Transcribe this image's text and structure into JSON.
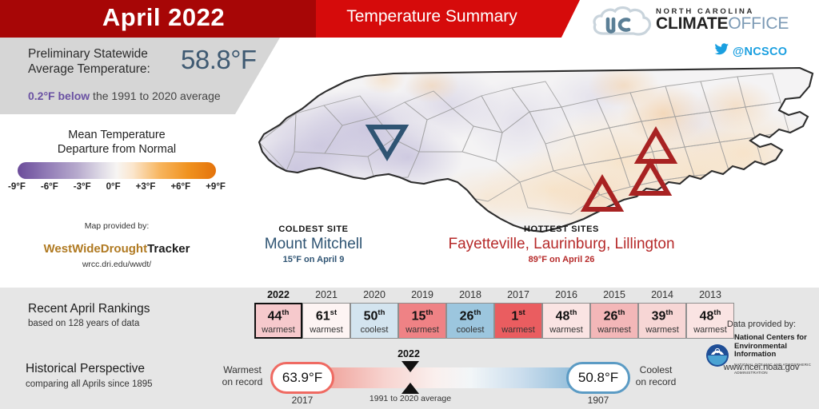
{
  "header": {
    "month_title": "April 2022",
    "summary_title": "Temperature Summary",
    "logo": {
      "line1": "NORTH CAROLINA",
      "climate": "CLIMATE",
      "office": "OFFICE"
    },
    "twitter_handle": "@NCSCO",
    "colors": {
      "banner_dark_red": "#A70606",
      "banner_bright_red": "#D60B0B"
    }
  },
  "stat_panel": {
    "label": "Preliminary Statewide Average Temperature:",
    "label_line1": "Preliminary Statewide",
    "label_line2": "Average Temperature:",
    "value": "58.8°F",
    "departure_value": "0.2°F below",
    "departure_rest": " the 1991 to 2020 average",
    "value_color": "#3f5a72",
    "departure_color": "#6a51a3"
  },
  "legend": {
    "title_line1": "Mean Temperature",
    "title_line2": "Departure from Normal",
    "ticks": [
      "-9°F",
      "-6°F",
      "-3°F",
      "0°F",
      "+3°F",
      "+6°F",
      "+9°F"
    ],
    "gradient_start": "#6b4c9a",
    "gradient_mid": "#f7f5f3",
    "gradient_end": "#e4730b"
  },
  "map_credit": {
    "label": "Map provided by:",
    "brand_part1": "WestWideDrought",
    "brand_part2": "Tracker",
    "url": "wrcc.dri.edu/wwdt/",
    "brand_color": "#b07a22"
  },
  "callouts": {
    "coldest": {
      "kicker": "COLDEST SITE",
      "name": "Mount Mitchell",
      "detail": "15°F on April 9",
      "color": "#2f5473"
    },
    "hottest": {
      "kicker": "HOTTEST SITES",
      "name": "Fayetteville, Laurinburg, Lillington",
      "detail": "89°F on April 26",
      "color": "#b62a2a"
    }
  },
  "rankings": {
    "title": "Recent April Rankings",
    "subtitle": "based on 128 years of data",
    "years": [
      "2022",
      "2021",
      "2020",
      "2019",
      "2018",
      "2017",
      "2016",
      "2015",
      "2014",
      "2013"
    ],
    "cells": [
      {
        "rank": "44",
        "suffix": "th",
        "word": "warmest",
        "bg": "#f6c9cc",
        "current": true
      },
      {
        "rank": "61",
        "suffix": "st",
        "word": "warmest",
        "bg": "#fdf4f3",
        "current": false
      },
      {
        "rank": "50",
        "suffix": "th",
        "word": "coolest",
        "bg": "#d3e4ef",
        "current": false
      },
      {
        "rank": "15",
        "suffix": "th",
        "word": "warmest",
        "bg": "#ef8285",
        "current": false
      },
      {
        "rank": "26",
        "suffix": "th",
        "word": "coolest",
        "bg": "#9cc6de",
        "current": false
      },
      {
        "rank": "1",
        "suffix": "st",
        "word": "warmest",
        "bg": "#ea5d60",
        "current": false
      },
      {
        "rank": "48",
        "suffix": "th",
        "word": "warmest",
        "bg": "#fae4e3",
        "current": false
      },
      {
        "rank": "26",
        "suffix": "th",
        "word": "warmest",
        "bg": "#f3b7b8",
        "current": false
      },
      {
        "rank": "39",
        "suffix": "th",
        "word": "warmest",
        "bg": "#f7d6d5",
        "current": false
      },
      {
        "rank": "48",
        "suffix": "th",
        "word": "warmest",
        "bg": "#fae4e3",
        "current": false
      }
    ]
  },
  "historical": {
    "title": "Historical Perspective",
    "subtitle": "comparing all Aprils since 1895",
    "warmest_label_line1": "Warmest",
    "warmest_label_line2": "on record",
    "coolest_label_line1": "Coolest",
    "coolest_label_line2": "on record",
    "warmest_value": "63.9°F",
    "warmest_year": "2017",
    "coolest_value": "50.8°F",
    "coolest_year": "1907",
    "marker_current_label": "2022",
    "marker_normal_label": "1991 to 2020 average",
    "bar_warm_color": "#e8736b",
    "bar_cool_color": "#5b9bc4"
  },
  "noaa": {
    "credit_label": "Data provided by:",
    "line1": "National Centers for",
    "line2": "Environmental Information",
    "line3": "NATIONAL OCEANIC AND ATMOSPHERIC ADMINISTRATION",
    "url": "www.ncei.noaa.gov"
  },
  "map": {
    "cold_marker_tooltip": "Mount Mitchell",
    "hot_marker_tooltip": "Fayetteville, Laurinburg, Lillington",
    "cold_marker_color": "#2f5473",
    "hot_marker_color": "#a82222"
  }
}
